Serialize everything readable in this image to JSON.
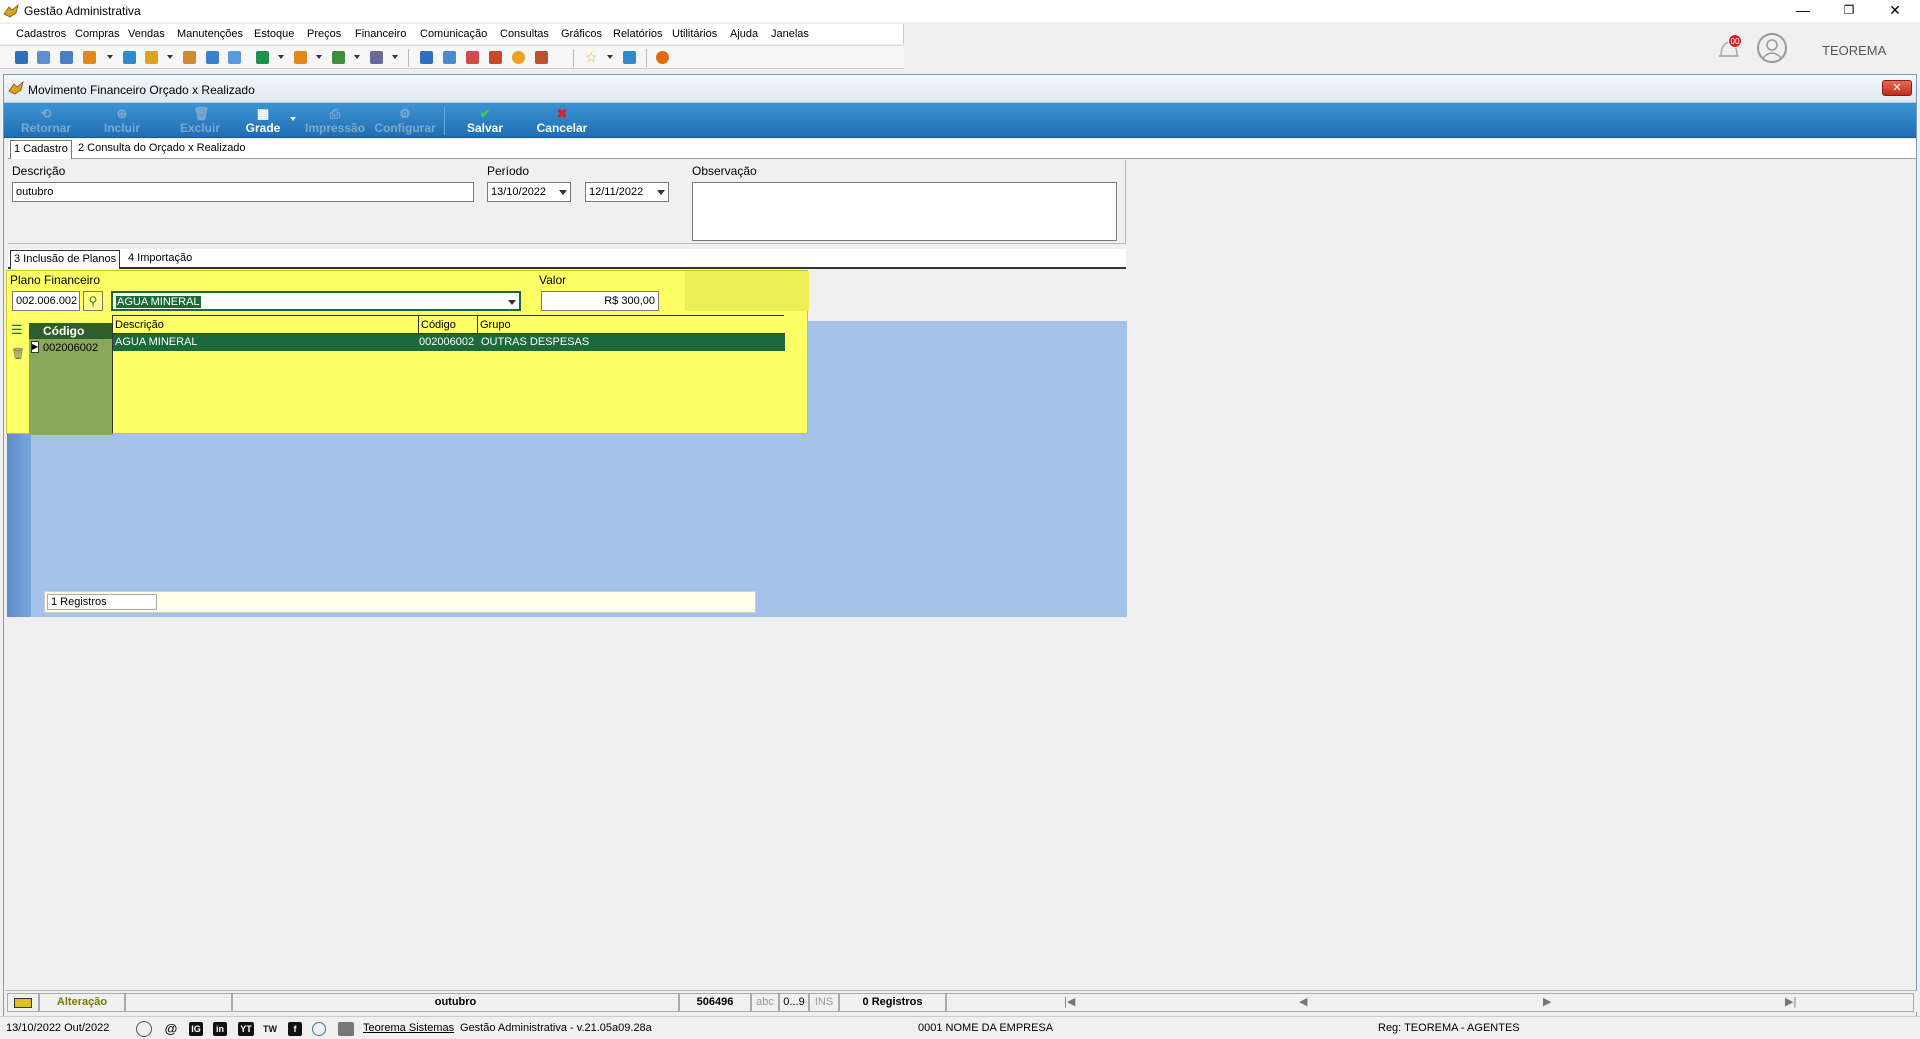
{
  "window": {
    "title": "Gestão Administrativa",
    "controls": [
      "—",
      "❐",
      "✕"
    ]
  },
  "menu": [
    "Cadastros",
    "Compras",
    "Vendas",
    "Manutenções",
    "Estoque",
    "Preços",
    "Financeiro",
    "Comunicação",
    "Consultas",
    "Gráficos",
    "Relatórios",
    "Utilitários",
    "Ajuda",
    "Janelas"
  ],
  "top_right": {
    "notification_count": "00",
    "user_name": "TEOREMA"
  },
  "child_window": {
    "title": "Movimento Financeiro Orçado x Realizado",
    "close_label": "✕"
  },
  "ribbon": {
    "retornar": "Retornar",
    "incluir": "Incluir",
    "excluir": "Excluir",
    "grade": "Grade",
    "impressao": "Impressão",
    "configurar": "Configurar",
    "salvar": "Salvar",
    "cancelar": "Cancelar"
  },
  "tabs_main": [
    "1 Cadastro",
    "2 Consulta do Orçado x Realizado"
  ],
  "form": {
    "descricao_label": "Descrição",
    "descricao_value": "outubro",
    "periodo_label": "Período",
    "periodo_inicio": "13/10/2022",
    "periodo_fim": "12/11/2022",
    "observacao_label": "Observação",
    "observacao_value": ""
  },
  "tabs_sub": [
    "3 Inclusão de Planos",
    "4 Importação"
  ],
  "plano": {
    "label": "Plano Financeiro",
    "codigo": "002.006.002",
    "descricao_selected": "AGUA MINERAL",
    "valor_label": "Valor",
    "valor": "R$ 300,00",
    "dropdown_headers": [
      "Descrição",
      "Código",
      "Grupo"
    ],
    "dropdown_rows": [
      [
        "AGUA MINERAL",
        "002006002",
        "OUTRAS DESPESAS"
      ]
    ]
  },
  "grid": {
    "header": "Código",
    "rows": [
      "002006002"
    ],
    "footer_count": "1 Registros"
  },
  "status": {
    "mode": "Alteração",
    "description": "outubro",
    "id": "506496",
    "abc": "abc",
    "num": "0...9",
    "ins": "INS",
    "records": "0 Registros",
    "nav_first": "|◀",
    "nav_prev": "◀",
    "nav_next": "▶",
    "nav_last": "▶|"
  },
  "footer": {
    "date": "13/10/2022 Out/2022",
    "company_link": "Teorema Sistemas",
    "version": "Gestão Administrativa - v.21.05a09.28a",
    "empresa": "0001 NOME DA EMPRESA",
    "reg": "Reg: TEOREMA - AGENTES",
    "social": [
      "@",
      "IG",
      "in",
      "YT",
      "TW",
      "f"
    ]
  }
}
